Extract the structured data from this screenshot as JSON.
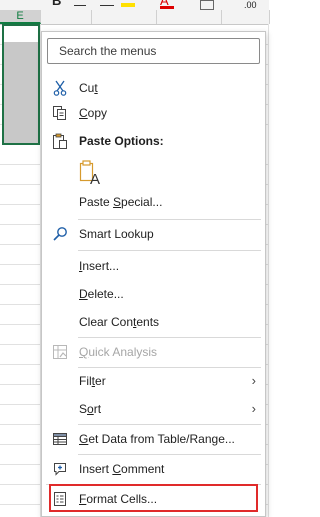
{
  "sheet": {
    "toolbar": {
      "bold_label": "B",
      "font_color_label": "A"
    },
    "selected_column_label": "E"
  },
  "menu": {
    "search": {
      "placeholder": "Search the menus"
    },
    "cut": {
      "label": "Cut",
      "icon": "scissors-icon"
    },
    "copy": {
      "label": "Copy",
      "icon": "copy-icon"
    },
    "paste_options": {
      "label": "Paste Options:",
      "icon": "clipboard-icon"
    },
    "paste_keep": {
      "icon": "paste-keep-formatting-icon",
      "glyph": "A"
    },
    "paste_special": {
      "label": "Paste Special..."
    },
    "smart_lookup": {
      "label": "Smart Lookup",
      "icon": "search-icon"
    },
    "insert": {
      "label": "Insert..."
    },
    "delete": {
      "label": "Delete..."
    },
    "clear_contents": {
      "label": "Clear Contents"
    },
    "quick_analysis": {
      "label": "Quick Analysis",
      "icon": "quick-analysis-icon",
      "disabled": true
    },
    "filter": {
      "label": "Filter",
      "arrow": "›"
    },
    "sort": {
      "label": "Sort",
      "arrow": "›"
    },
    "get_data": {
      "label": "Get Data from Table/Range...",
      "icon": "table-icon"
    },
    "insert_comment": {
      "label": "Insert Comment",
      "icon": "comment-icon"
    },
    "format_cells": {
      "label": "Format Cells...",
      "icon": "format-cells-icon",
      "highlighted": true
    }
  },
  "colors": {
    "selection_border": "#1e7145",
    "highlight_border": "#e02a2a",
    "icon_blue": "#1f5fa8"
  }
}
